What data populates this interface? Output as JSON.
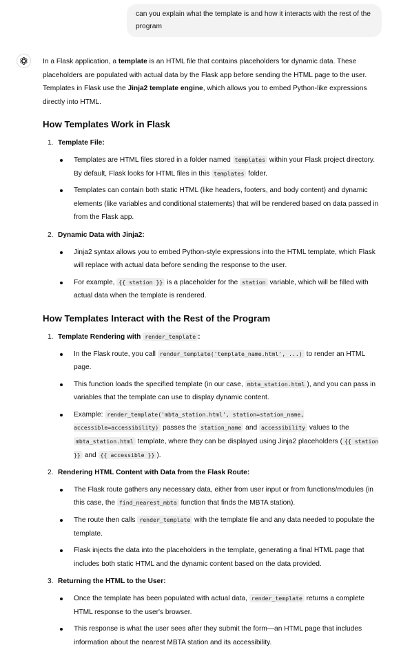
{
  "user_message": "can you explain what the template is and how it interacts with the rest of the program",
  "intro": {
    "p1": "In a Flask application, a ",
    "term": "template",
    "p2": " is an HTML file that contains placeholders for dynamic data. These placeholders are populated with actual data by the Flask app before sending the HTML page to the user. Templates in Flask use the ",
    "engine": "Jinja2 template engine",
    "p3": ", which allows you to embed Python-like expressions directly into HTML."
  },
  "section1": {
    "heading": "How Templates Work in Flask",
    "items": [
      {
        "num": "1.",
        "title": "Template File:",
        "b1_t1": "Templates are HTML files stored in a folder named ",
        "b1_c1": "templates",
        "b1_t2": " within your Flask project directory. By default, Flask looks for HTML files in this ",
        "b1_c2": "templates",
        "b1_t3": " folder.",
        "b2": "Templates can contain both static HTML (like headers, footers, and body content) and dynamic elements (like variables and conditional statements) that will be rendered based on data passed in from the Flask app."
      },
      {
        "num": "2.",
        "title": "Dynamic Data with Jinja2:",
        "b1": "Jinja2 syntax allows you to embed Python-style expressions into the HTML template, which Flask will replace with actual data before sending the response to the user.",
        "b2_t1": "For example, ",
        "b2_c1": "{{ station }}",
        "b2_t2": " is a placeholder for the ",
        "b2_c2": "station",
        "b2_t3": " variable, which will be filled with actual data when the template is rendered."
      }
    ]
  },
  "section2": {
    "heading": "How Templates Interact with the Rest of the Program",
    "items": [
      {
        "num": "1.",
        "title_text": "Template Rendering with ",
        "title_code": "render_template",
        "title_end": ":",
        "b1_t1": "In the Flask route, you call ",
        "b1_c1": "render_template('template_name.html', ...)",
        "b1_t2": " to render an HTML page.",
        "b2_t1": "This function loads the specified template (in our case, ",
        "b2_c1": "mbta_station.html",
        "b2_t2": "), and you can pass in variables that the template can use to display dynamic content.",
        "b3_t1": "Example: ",
        "b3_c1": "render_template('mbta_station.html', station=station_name, accessible=accessibility)",
        "b3_t2": " passes the ",
        "b3_c2": "station_name",
        "b3_t3": " and ",
        "b3_c3": "accessibility",
        "b3_t4": " values to the ",
        "b3_c4": "mbta_station.html",
        "b3_t5": " template, where they can be displayed using Jinja2 placeholders (",
        "b3_c5": "{{ station }}",
        "b3_t6": " and ",
        "b3_c6": "{{ accessible }}",
        "b3_t7": ")."
      },
      {
        "num": "2.",
        "title": "Rendering HTML Content with Data from the Flask Route:",
        "b1_t1": "The Flask route gathers any necessary data, either from user input or from functions/modules (in this case, the ",
        "b1_c1": "find_nearest_mbta",
        "b1_t2": " function that finds the MBTA station).",
        "b2_t1": "The route then calls ",
        "b2_c1": "render_template",
        "b2_t2": " with the template file and any data needed to populate the template.",
        "b3": "Flask injects the data into the placeholders in the template, generating a final HTML page that includes both static HTML and the dynamic content based on the data provided."
      },
      {
        "num": "3.",
        "title": "Returning the HTML to the User:",
        "b1_t1": "Once the template has been populated with actual data, ",
        "b1_c1": "render_template",
        "b1_t2": " returns a complete HTML response to the user's browser.",
        "b2": "This response is what the user sees after they submit the form—an HTML page that includes information about the nearest MBTA station and its accessibility."
      }
    ]
  }
}
